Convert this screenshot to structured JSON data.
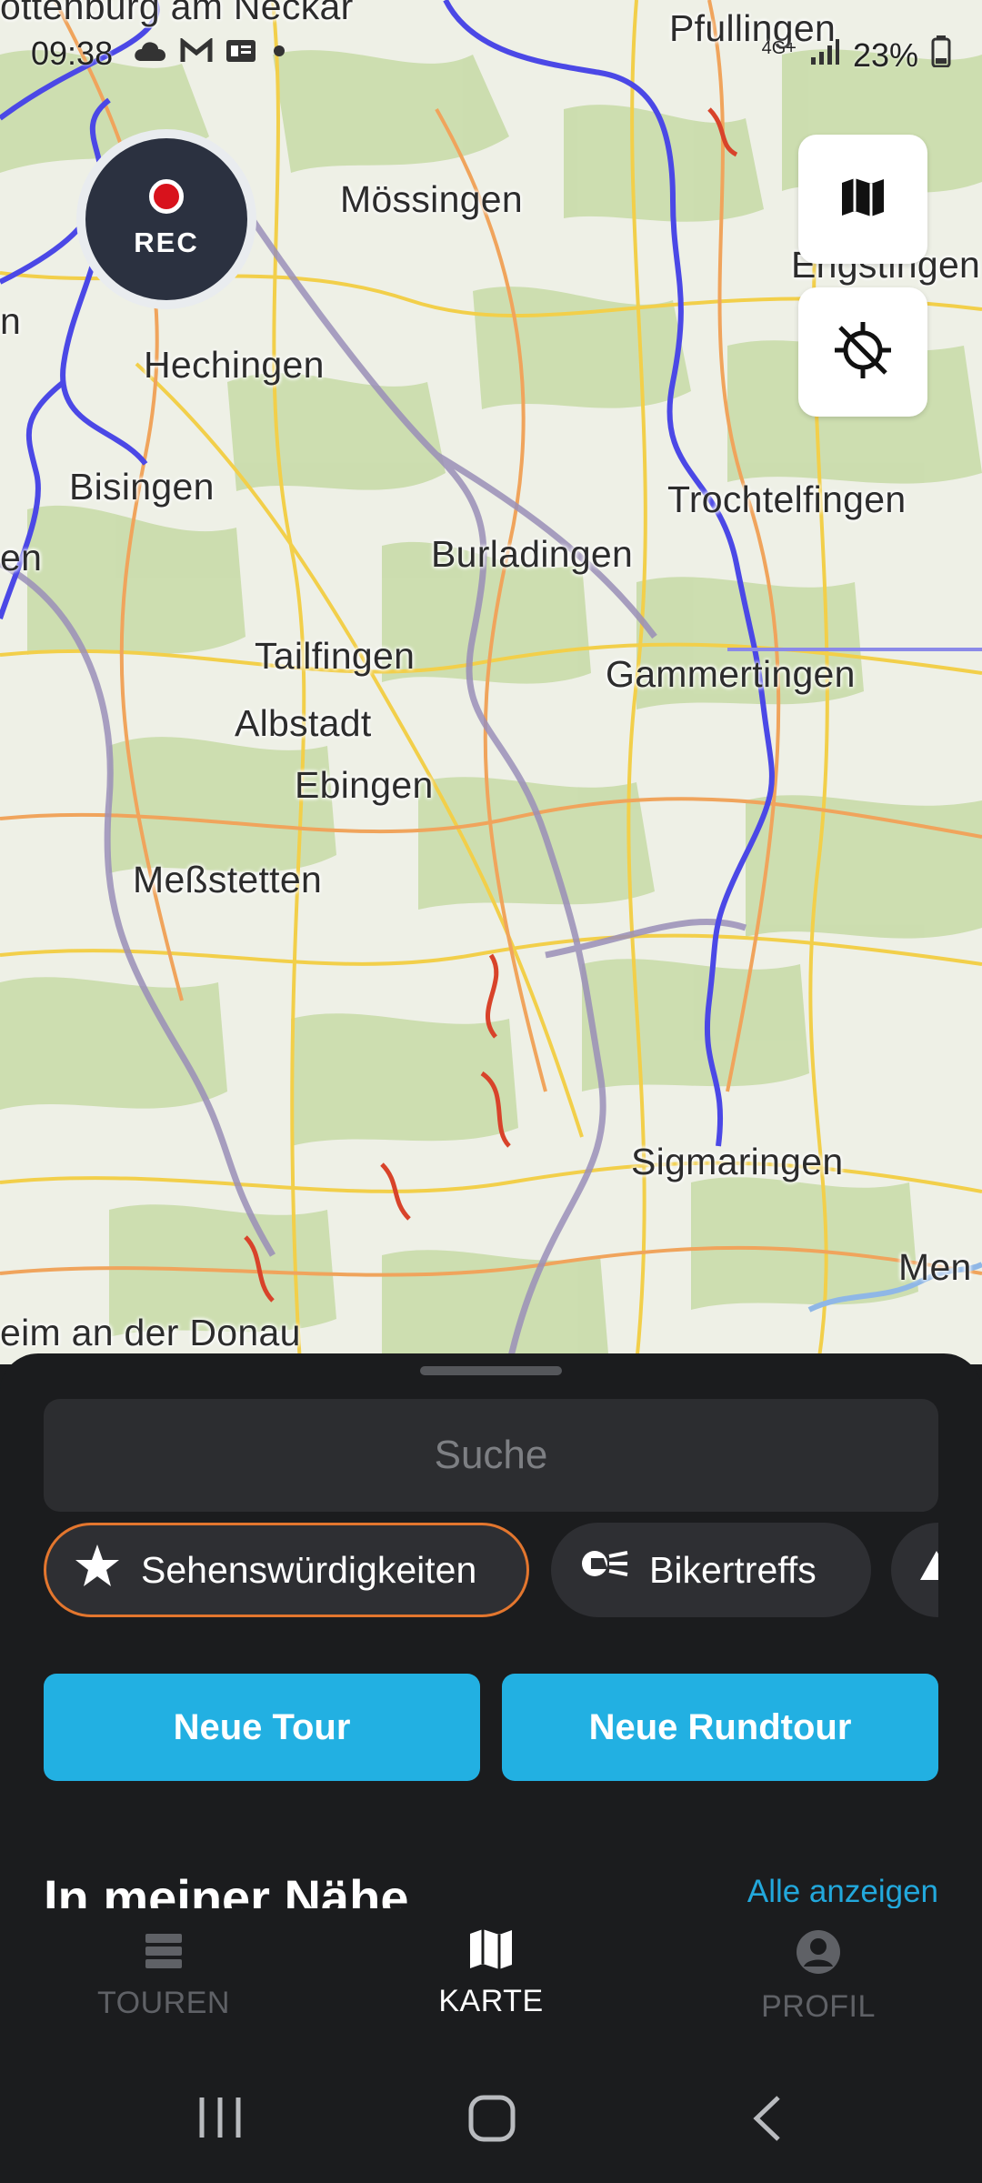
{
  "statusbar": {
    "time": "09:38",
    "network": "4G+",
    "battery": "23%"
  },
  "map": {
    "places": [
      {
        "name": "ottenburg am Neckar"
      },
      {
        "name": "Pfullingen"
      },
      {
        "name": "Mössingen"
      },
      {
        "name": "Engstingen"
      },
      {
        "name": "Hechingen"
      },
      {
        "name": "Bisingen"
      },
      {
        "name": "Trochtelfingen"
      },
      {
        "name": "Burladingen"
      },
      {
        "name": "Tailfingen"
      },
      {
        "name": "Gammertingen"
      },
      {
        "name": "Albstadt"
      },
      {
        "name": "Ebingen"
      },
      {
        "name": "Meßstetten"
      },
      {
        "name": "Sigmaringen"
      },
      {
        "name": "Men"
      },
      {
        "name": "eim an der Donau"
      },
      {
        "name": "en"
      },
      {
        "name": "n"
      }
    ],
    "rec_label": "REC",
    "layers_icon": "map-icon",
    "locate_icon": "gps-off-icon"
  },
  "sheet": {
    "search_placeholder": "Suche",
    "chips": [
      {
        "label": "Sehenswürdigkeiten",
        "icon": "star-icon",
        "active": true
      },
      {
        "label": "Bikertreffs",
        "icon": "biker-icon",
        "active": false
      },
      {
        "label": "",
        "icon": "triangle-icon",
        "active": false
      }
    ],
    "new_tour": "Neue Tour",
    "new_round_tour": "Neue Rundtour",
    "section_title": "In meiner Nähe",
    "section_link": "Alle anzeigen"
  },
  "nav": {
    "items": [
      {
        "label": "TOUREN",
        "icon": "list-icon",
        "active": false
      },
      {
        "label": "KARTE",
        "icon": "map-icon",
        "active": true
      },
      {
        "label": "PROFIL",
        "icon": "profile-icon",
        "active": false
      }
    ]
  },
  "colors": {
    "accent": "#22b0e2",
    "active_chip_border": "#e3762e",
    "sheet_bg": "#1b1c1e",
    "rec_red": "#d8121c"
  }
}
